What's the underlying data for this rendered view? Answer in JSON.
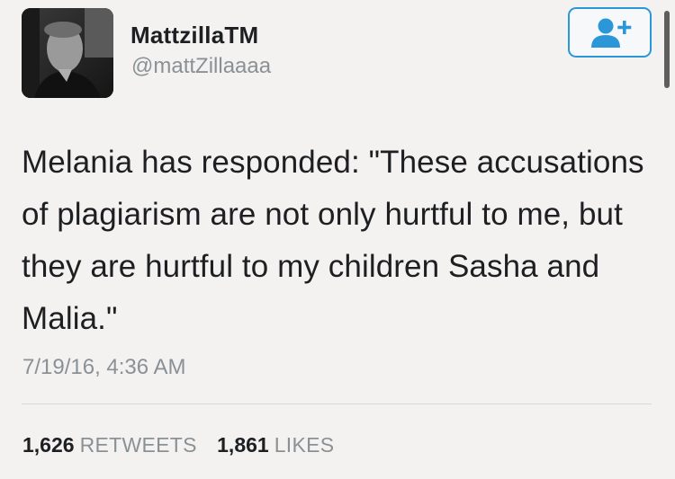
{
  "user": {
    "display_name": "MattzillaTM",
    "handle": "@mattZillaaaa",
    "avatar_icon": "profile-photo-icon",
    "follow_icon": "add-person-icon"
  },
  "tweet": {
    "text": "Melania has responded: \"These accusations of plagiarism are not only hurtful to me, but they are hurtful to my children Sasha and Malia.\"",
    "timestamp": "7/19/16, 4:36 AM"
  },
  "stats": {
    "retweets_count": "1,626",
    "retweets_label": "RETWEETS",
    "likes_count": "1,861",
    "likes_label": "LIKES"
  },
  "colors": {
    "accent": "#2b97d8",
    "muted_text": "#8a9196",
    "primary_text": "#1d1f22",
    "background": "#f3f2f0"
  }
}
